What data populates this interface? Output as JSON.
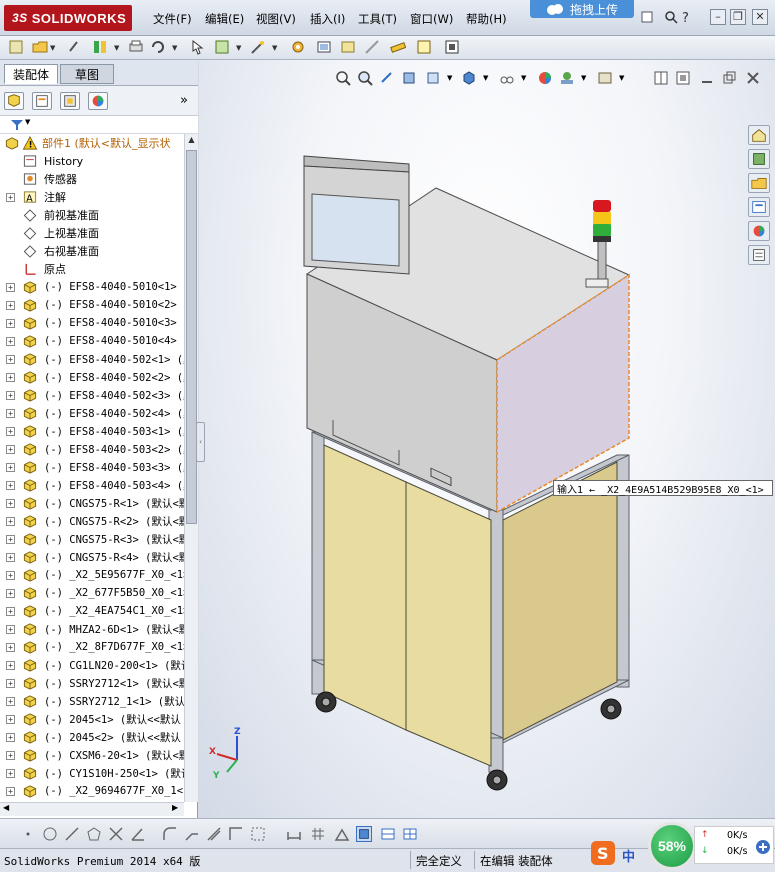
{
  "app": {
    "logo_text": "SOLIDWORKS",
    "logo_prefix": "3S"
  },
  "menu": [
    "文件(F)",
    "编辑(E)",
    "视图(V)",
    "插入(I)",
    "工具(T)",
    "窗口(W)",
    "帮助(H)"
  ],
  "upload_button": "拖拽上传",
  "window_controls": [
    "minimize",
    "restore",
    "close"
  ],
  "panel": {
    "tabs": [
      "装配体",
      "草图"
    ],
    "active_tab": 0,
    "collapse_glyph": "»"
  },
  "tree": {
    "root": "部件1  (默认<默认_显示状",
    "items": [
      {
        "label": "History",
        "icon": "history-icon",
        "expand": false
      },
      {
        "label": "传感器",
        "icon": "sensor-icon",
        "expand": false
      },
      {
        "label": "注解",
        "icon": "annotation-icon",
        "expand": true
      },
      {
        "label": "前视基准面",
        "icon": "plane-icon",
        "expand": false
      },
      {
        "label": "上视基准面",
        "icon": "plane-icon",
        "expand": false
      },
      {
        "label": "右视基准面",
        "icon": "plane-icon",
        "expand": false
      },
      {
        "label": "原点",
        "icon": "origin-icon",
        "expand": false
      },
      {
        "label": "(-) EFS8-4040-5010<1> (",
        "icon": "part-icon",
        "expand": true
      },
      {
        "label": "(-) EFS8-4040-5010<2> (",
        "icon": "part-icon",
        "expand": true
      },
      {
        "label": "(-) EFS8-4040-5010<3> (",
        "icon": "part-icon",
        "expand": true
      },
      {
        "label": "(-) EFS8-4040-5010<4> (",
        "icon": "part-icon",
        "expand": true
      },
      {
        "label": "(-) EFS8-4040-502<1> (默",
        "icon": "part-icon",
        "expand": true
      },
      {
        "label": "(-) EFS8-4040-502<2> (默",
        "icon": "part-icon",
        "expand": true
      },
      {
        "label": "(-) EFS8-4040-502<3> (默",
        "icon": "part-icon",
        "expand": true
      },
      {
        "label": "(-) EFS8-4040-502<4> (默",
        "icon": "part-icon",
        "expand": true
      },
      {
        "label": "(-) EFS8-4040-503<1> (默",
        "icon": "part-icon",
        "expand": true
      },
      {
        "label": "(-) EFS8-4040-503<2> (默",
        "icon": "part-icon",
        "expand": true
      },
      {
        "label": "(-) EFS8-4040-503<3> (默",
        "icon": "part-icon",
        "expand": true
      },
      {
        "label": "(-) EFS8-4040-503<4> (默",
        "icon": "part-icon",
        "expand": true
      },
      {
        "label": "(-) CNGS75-R<1> (默认<默",
        "icon": "part-icon",
        "expand": true
      },
      {
        "label": "(-) CNGS75-R<2> (默认<默",
        "icon": "part-icon",
        "expand": true
      },
      {
        "label": "(-) CNGS75-R<3> (默认<默",
        "icon": "part-icon",
        "expand": true
      },
      {
        "label": "(-) CNGS75-R<4> (默认<默",
        "icon": "part-icon",
        "expand": true
      },
      {
        "label": "(-) _X2_5E95677F_X0_<1>",
        "icon": "part-icon",
        "expand": true
      },
      {
        "label": "(-) _X2_677F5B50_X0_<1>",
        "icon": "part-icon",
        "expand": true
      },
      {
        "label": "(-) _X2_4EA754C1_X0_<1>",
        "icon": "part-icon",
        "expand": true
      },
      {
        "label": "(-) MHZA2-6D<1> (默认<默",
        "icon": "part-icon",
        "expand": true
      },
      {
        "label": "(-) _X2_8F7D677F_X0_<1>",
        "icon": "part-icon",
        "expand": true
      },
      {
        "label": "(-) CG1LN20-200<1> (默认",
        "icon": "part-icon",
        "expand": true
      },
      {
        "label": "(-) SSRY2712<1> (默认<默",
        "icon": "part-icon",
        "expand": true
      },
      {
        "label": "(-) SSRY2712_1<1> (默认",
        "icon": "part-icon",
        "expand": true
      },
      {
        "label": "(-) 2045<1> (默认<<默认",
        "icon": "part-icon",
        "expand": true
      },
      {
        "label": "(-) 2045<2> (默认<<默认",
        "icon": "part-icon",
        "expand": true
      },
      {
        "label": "(-) CXSM6-20<1> (默认<默",
        "icon": "part-icon",
        "expand": true
      },
      {
        "label": "(-) CY1S10H-250<1> (默认",
        "icon": "part-icon",
        "expand": true
      },
      {
        "label": "(-) _X2_9694677F_X0_1<1",
        "icon": "part-icon",
        "expand": true
      }
    ]
  },
  "tooltip": "输入1 ← _X2_4E9A514B529B95E8_X0_<1>",
  "triad": {
    "x": "X",
    "y": "Y",
    "z": "Z"
  },
  "status": {
    "product": "SolidWorks Premium 2014 x64 版",
    "definition": "完全定义",
    "editing": "在编辑 装配体",
    "network_percent": "58%",
    "upload_rate": "0K/s",
    "download_rate": "0K/s",
    "ime_label": "中"
  },
  "colors": {
    "accent_red": "#b3151c",
    "cabinet_yellow": "#e8dca0",
    "cabinet_gray": "#d9d9d9",
    "selection_orange": "#e88a2a",
    "upload_blue": "#4a90d9",
    "speed_green": "#1e9b47"
  }
}
